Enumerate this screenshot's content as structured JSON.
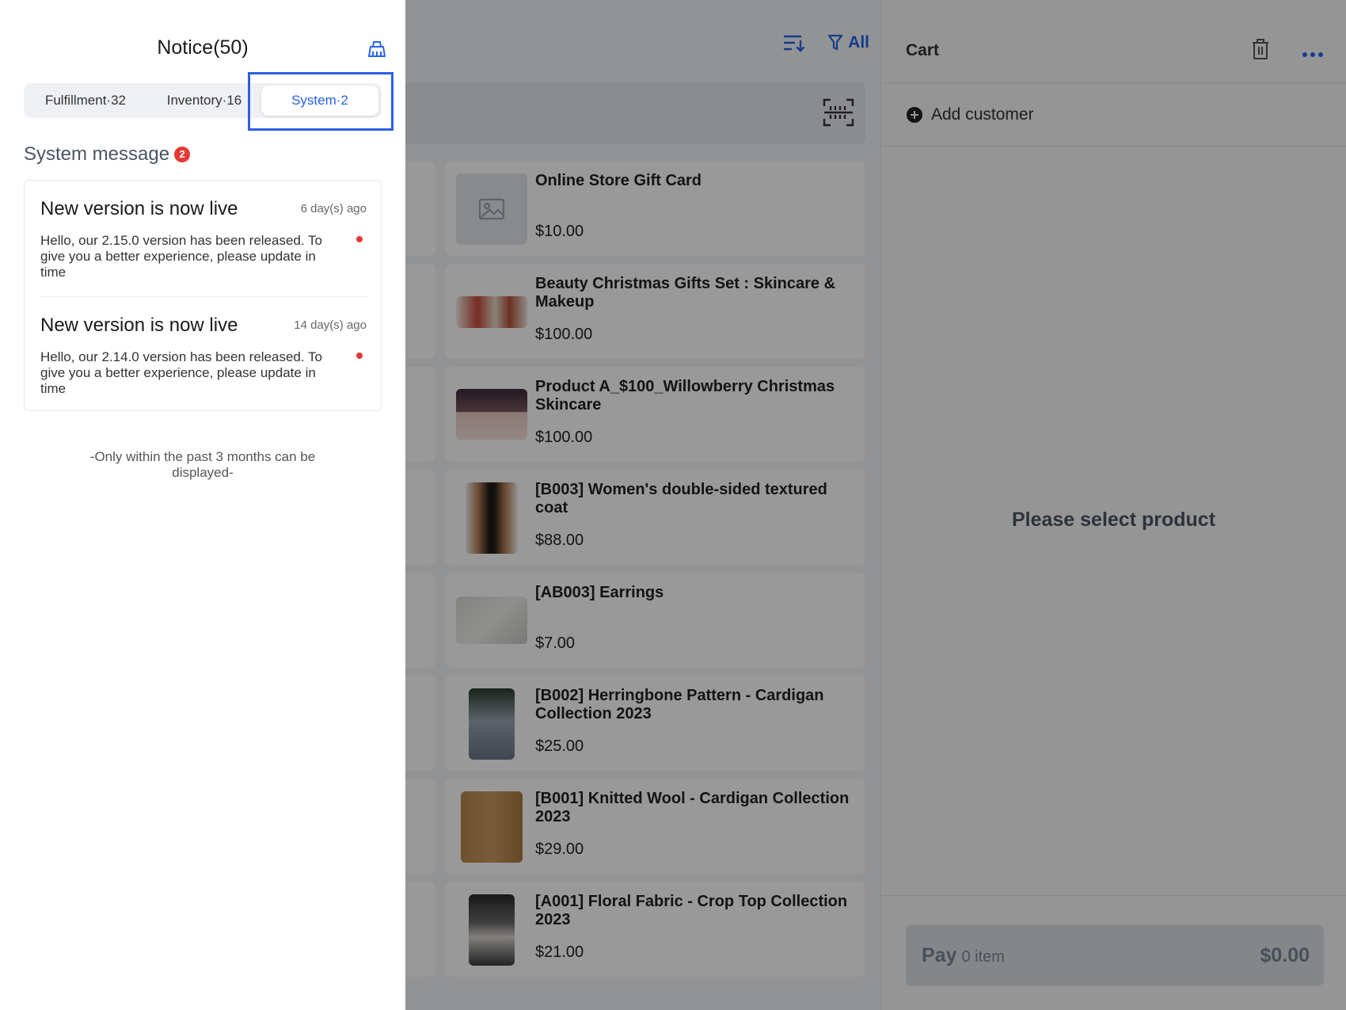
{
  "toolbar": {
    "filter_label": "All"
  },
  "products": [
    {
      "name": "Online Store Gift Card",
      "price": "$10.00",
      "thumb": "placeholder-image-icon"
    },
    {
      "name": "Beauty Christmas Gifts Set : Skincare & Makeup",
      "price": "$100.00",
      "thumb": "gift-set-photo"
    },
    {
      "name": "Product A_$100_Willowberry Christmas Skincare",
      "price": "$100.00",
      "thumb": "skincare-photo"
    },
    {
      "name": "[B003] Women's double-sided textured coat",
      "price": "$88.00",
      "thumb": "coat-photo"
    },
    {
      "name": "[AB003] Earrings",
      "price": "$7.00",
      "thumb": "earrings-photo"
    },
    {
      "name": "[B002] Herringbone Pattern - Cardigan Collection 2023",
      "price": "$25.00",
      "thumb": "cardigan-photo"
    },
    {
      "name": "[B001] Knitted Wool - Cardigan Collection 2023",
      "price": "$29.00",
      "thumb": "knit-cardigan-photo"
    },
    {
      "name": "[A001] Floral Fabric - Crop Top Collection 2023",
      "price": "$21.00",
      "thumb": "crop-top-photo"
    }
  ],
  "cart": {
    "title": "Cart",
    "add_customer_label": "Add customer",
    "empty_text": "Please select product",
    "pay_label": "Pay",
    "pay_count": "0 item",
    "pay_total": "$0.00"
  },
  "notice": {
    "title": "Notice(50)",
    "tabs": [
      {
        "label": "Fulfillment·32"
      },
      {
        "label": "Inventory·16"
      },
      {
        "label": "System·2"
      }
    ],
    "active_tab": "System·2",
    "section_title": "System message",
    "section_badge": "2",
    "messages": [
      {
        "title": "New version is now live",
        "time": "6 day(s) ago",
        "body": "Hello, our 2.15.0 version has been released. To give you a better experience, please update in time"
      },
      {
        "title": "New version is now live",
        "time": "14 day(s) ago",
        "body": "Hello, our 2.14.0 version has been released. To give you a better experience, please update in time"
      }
    ],
    "footnote": "-Only within the past 3 months can be displayed-"
  },
  "colors": {
    "accent": "#2563eb",
    "highlight_border": "#2f5fe0",
    "badge": "#e53935",
    "overlay": "rgba(0,0,0,0.40)"
  }
}
